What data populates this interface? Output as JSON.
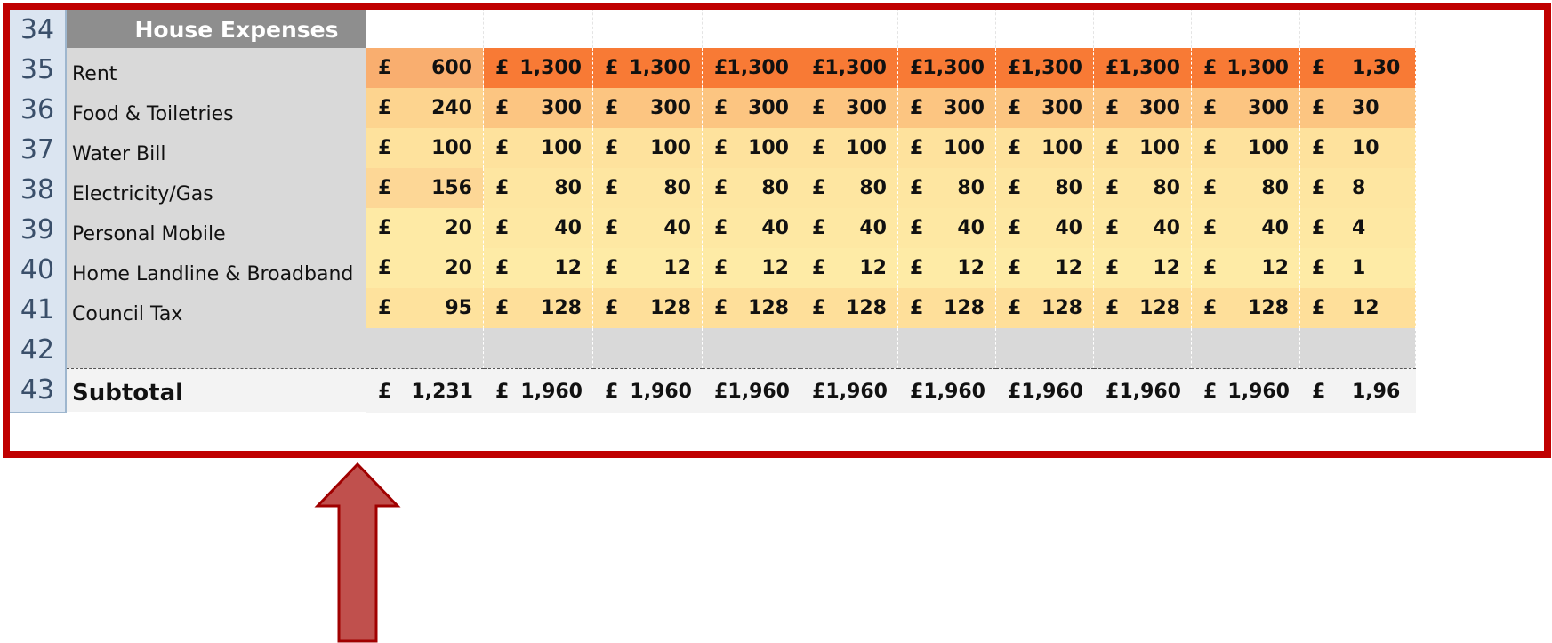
{
  "colors": {
    "frame": "#c00000",
    "arrow_fill": "#c0504d",
    "arrow_stroke": "#a00000",
    "header_bg": "#8e8e8e"
  },
  "section_header": "House Expenses",
  "currency": "£",
  "rows": [
    {
      "row_num": "34",
      "label": "",
      "kind": "header",
      "values": []
    },
    {
      "row_num": "35",
      "label": "Rent",
      "kind": "data",
      "values": [
        "600",
        "1,300",
        "1,300",
        "1,300",
        "1,300",
        "1,300",
        "1,300",
        "1,300",
        "1,300",
        "1,30"
      ],
      "colors": [
        "#f9ae6f",
        "#f87a35",
        "#f87a35",
        "#f87a35",
        "#f87a35",
        "#f87a35",
        "#f87a35",
        "#f87a35",
        "#f87a35",
        "#f87a35"
      ]
    },
    {
      "row_num": "36",
      "label": "Food & Toiletries",
      "kind": "data",
      "values": [
        "240",
        "300",
        "300",
        "300",
        "300",
        "300",
        "300",
        "300",
        "300",
        "30"
      ],
      "colors": [
        "#fdd48f",
        "#fcc581",
        "#fcc581",
        "#fcc581",
        "#fcc581",
        "#fcc581",
        "#fcc581",
        "#fcc581",
        "#fcc581",
        "#fcc581"
      ]
    },
    {
      "row_num": "37",
      "label": "Water Bill",
      "kind": "data",
      "values": [
        "100",
        "100",
        "100",
        "100",
        "100",
        "100",
        "100",
        "100",
        "100",
        "10"
      ],
      "colors": [
        "#fee29d",
        "#fee29d",
        "#fee29d",
        "#fee29d",
        "#fee29d",
        "#fee29d",
        "#fee29d",
        "#fee29d",
        "#fee29d",
        "#fee29d"
      ]
    },
    {
      "row_num": "38",
      "label": "Electricity/Gas",
      "kind": "data",
      "values": [
        "156",
        "80",
        "80",
        "80",
        "80",
        "80",
        "80",
        "80",
        "80",
        "8"
      ],
      "colors": [
        "#fdd796",
        "#fee6a1",
        "#fee6a1",
        "#fee6a1",
        "#fee6a1",
        "#fee6a1",
        "#fee6a1",
        "#fee6a1",
        "#fee6a1",
        "#fee6a1"
      ]
    },
    {
      "row_num": "39",
      "label": "Personal Mobile",
      "kind": "data",
      "values": [
        "20",
        "40",
        "40",
        "40",
        "40",
        "40",
        "40",
        "40",
        "40",
        "4"
      ],
      "colors": [
        "#feeaa5",
        "#fee8a3",
        "#fee8a3",
        "#fee8a3",
        "#fee8a3",
        "#fee8a3",
        "#fee8a3",
        "#fee8a3",
        "#fee8a3",
        "#fee8a3"
      ]
    },
    {
      "row_num": "40",
      "label": "Home Landline & Broadband",
      "kind": "data",
      "values": [
        "20",
        "12",
        "12",
        "12",
        "12",
        "12",
        "12",
        "12",
        "12",
        "1"
      ],
      "colors": [
        "#feeaa5",
        "#feeba6",
        "#feeba6",
        "#feeba6",
        "#feeba6",
        "#feeba6",
        "#feeba6",
        "#feeba6",
        "#feeba6",
        "#feeba6"
      ]
    },
    {
      "row_num": "41",
      "label": "Council Tax",
      "kind": "data",
      "values": [
        "95",
        "128",
        "128",
        "128",
        "128",
        "128",
        "128",
        "128",
        "128",
        "12"
      ],
      "colors": [
        "#fee29d",
        "#fedf9a",
        "#fedf9a",
        "#fedf9a",
        "#fedf9a",
        "#fedf9a",
        "#fedf9a",
        "#fedf9a",
        "#fedf9a",
        "#fedf9a"
      ]
    },
    {
      "row_num": "42",
      "label": "",
      "kind": "blank",
      "values": []
    },
    {
      "row_num": "43",
      "label": "Subtotal",
      "kind": "subtotal",
      "values": [
        "1,231",
        "1,960",
        "1,960",
        "1,960",
        "1,960",
        "1,960",
        "1,960",
        "1,960",
        "1,960",
        "1,96"
      ]
    }
  ]
}
